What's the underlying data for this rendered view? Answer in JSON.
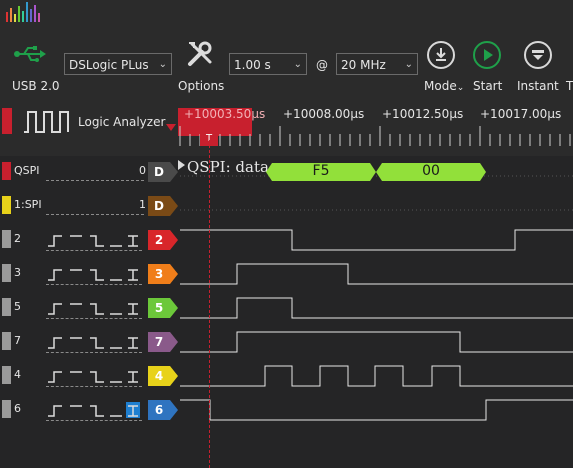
{
  "toolbar": {
    "usb_label": "USB 2.0",
    "device": "DSLogic PLus",
    "options_label": "Options",
    "duration": "1.00 s",
    "at": "@",
    "rate": "20 MHz",
    "mode_label": "Mode",
    "start_label": "Start",
    "instant_label": "Instant",
    "trailing_label": "T"
  },
  "header": {
    "analyzer_label": "Logic Analyzer",
    "cursor_time": "+10003.50μs",
    "ticks": [
      "+10008.00μs",
      "+10012.50μs",
      "+10017.00μs"
    ],
    "trigger_marker": "T"
  },
  "decoder": {
    "name": "QSPI",
    "index": "0",
    "tag": "D",
    "annotation_label": "QSPI: data",
    "values": [
      "F5",
      "00"
    ]
  },
  "spi_row": {
    "name": "1:SPI",
    "index": "1",
    "tag": "D"
  },
  "channels": [
    {
      "name": "2",
      "tag": "2",
      "color": "#d8262a"
    },
    {
      "name": "3",
      "tag": "3",
      "color": "#f07e1a"
    },
    {
      "name": "5",
      "tag": "5",
      "color": "#6cc83a"
    },
    {
      "name": "7",
      "tag": "7",
      "color": "#8a5a8a"
    },
    {
      "name": "4",
      "tag": "4",
      "color": "#e8d21a"
    },
    {
      "name": "6",
      "tag": "6",
      "color": "#2f74c0"
    }
  ],
  "colors": {
    "accent_red": "#c8202e",
    "accent_green": "#1fa04a",
    "decoder_green": "#92e03a",
    "trigger_blue": "#1f7fd0"
  }
}
